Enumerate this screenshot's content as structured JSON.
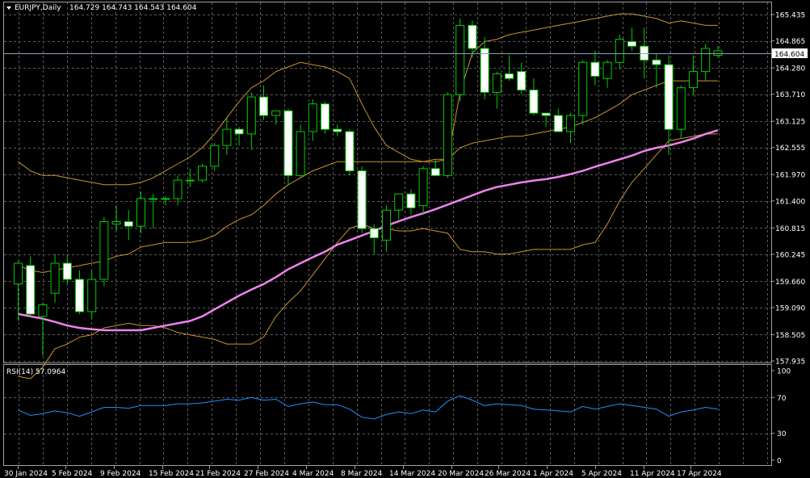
{
  "header": {
    "symbol_label": "EURJPY,Daily",
    "ohlc_text": "164.729 164.743 164.543 164.604",
    "rsi_label": "RSI(14) 57.0964"
  },
  "colors": {
    "background": "#000000",
    "grid": "#5a5a5a",
    "frame": "#a0a0a0",
    "candle_up_fill": "#000000",
    "candle_down_fill": "#ffffff",
    "candle_border": "#00cc00",
    "bollinger": "#c89430",
    "moving_average": "#ee82ee",
    "rsi_line": "#1e90ff",
    "price_line": "#8aa0c0"
  },
  "chart_data": [
    {
      "type": "candlestick",
      "symbol": "EURJPY",
      "timeframe": "Daily",
      "last_price": 164.604,
      "ylim": [
        157.935,
        165.435
      ],
      "y_ticks": [
        "165.435",
        "164.865",
        "164.280",
        "163.710",
        "163.125",
        "162.555",
        "161.970",
        "161.400",
        "160.815",
        "160.245",
        "159.660",
        "159.090",
        "158.505",
        "157.935"
      ],
      "x_ticks": [
        "30 Jan 2024",
        "5 Feb 2024",
        "9 Feb 2024",
        "15 Feb 2024",
        "21 Feb 2024",
        "27 Feb 2024",
        "4 Mar 2024",
        "8 Mar 2024",
        "14 Mar 2024",
        "20 Mar 2024",
        "26 Mar 2024",
        "1 Apr 2024",
        "5 Apr 2024",
        "11 Apr 2024",
        "17 Apr 2024"
      ],
      "candles": [
        {
          "o": 159.6,
          "h": 160.1,
          "l": 158.8,
          "c": 160.05
        },
        {
          "o": 160.0,
          "h": 160.2,
          "l": 158.9,
          "c": 158.95
        },
        {
          "o": 158.9,
          "h": 159.2,
          "l": 158.05,
          "c": 159.15
        },
        {
          "o": 159.4,
          "h": 160.25,
          "l": 159.2,
          "c": 160.05
        },
        {
          "o": 160.05,
          "h": 160.25,
          "l": 159.6,
          "c": 159.7
        },
        {
          "o": 159.7,
          "h": 159.9,
          "l": 158.95,
          "c": 159.0
        },
        {
          "o": 159.0,
          "h": 159.9,
          "l": 158.85,
          "c": 159.7
        },
        {
          "o": 159.7,
          "h": 161.05,
          "l": 159.55,
          "c": 160.95
        },
        {
          "o": 160.9,
          "h": 161.3,
          "l": 160.75,
          "c": 160.95
        },
        {
          "o": 160.95,
          "h": 161.2,
          "l": 160.55,
          "c": 160.85
        },
        {
          "o": 160.85,
          "h": 161.6,
          "l": 160.7,
          "c": 161.45
        },
        {
          "o": 161.45,
          "h": 161.55,
          "l": 160.8,
          "c": 161.45
        },
        {
          "o": 161.45,
          "h": 161.5,
          "l": 161.3,
          "c": 161.45
        },
        {
          "o": 161.45,
          "h": 161.95,
          "l": 161.3,
          "c": 161.85
        },
        {
          "o": 161.85,
          "h": 162.1,
          "l": 161.7,
          "c": 161.85
        },
        {
          "o": 161.85,
          "h": 162.2,
          "l": 161.8,
          "c": 162.15
        },
        {
          "o": 162.15,
          "h": 162.65,
          "l": 162.05,
          "c": 162.6
        },
        {
          "o": 162.6,
          "h": 163.2,
          "l": 162.4,
          "c": 162.95
        },
        {
          "o": 162.95,
          "h": 163.0,
          "l": 162.6,
          "c": 162.85
        },
        {
          "o": 162.85,
          "h": 163.75,
          "l": 162.5,
          "c": 163.65
        },
        {
          "o": 163.65,
          "h": 163.9,
          "l": 163.15,
          "c": 163.25
        },
        {
          "o": 163.25,
          "h": 163.35,
          "l": 163.05,
          "c": 163.35
        },
        {
          "o": 163.35,
          "h": 163.4,
          "l": 161.75,
          "c": 161.95
        },
        {
          "o": 161.95,
          "h": 163.05,
          "l": 161.9,
          "c": 162.9
        },
        {
          "o": 162.9,
          "h": 163.6,
          "l": 162.7,
          "c": 163.5
        },
        {
          "o": 163.5,
          "h": 163.55,
          "l": 162.85,
          "c": 162.95
        },
        {
          "o": 162.95,
          "h": 163.05,
          "l": 162.8,
          "c": 162.9
        },
        {
          "o": 162.9,
          "h": 162.95,
          "l": 161.95,
          "c": 162.05
        },
        {
          "o": 162.05,
          "h": 162.15,
          "l": 160.7,
          "c": 160.8
        },
        {
          "o": 160.8,
          "h": 160.9,
          "l": 160.25,
          "c": 160.6
        },
        {
          "o": 160.55,
          "h": 161.3,
          "l": 160.3,
          "c": 161.2
        },
        {
          "o": 161.2,
          "h": 161.55,
          "l": 161.0,
          "c": 161.55
        },
        {
          "o": 161.55,
          "h": 161.65,
          "l": 161.1,
          "c": 161.25
        },
        {
          "o": 161.3,
          "h": 162.15,
          "l": 161.1,
          "c": 162.1
        },
        {
          "o": 162.1,
          "h": 162.3,
          "l": 161.95,
          "c": 161.95
        },
        {
          "o": 161.95,
          "h": 163.75,
          "l": 161.9,
          "c": 163.7
        },
        {
          "o": 163.7,
          "h": 165.35,
          "l": 163.55,
          "c": 165.2
        },
        {
          "o": 165.2,
          "h": 165.3,
          "l": 164.5,
          "c": 164.7
        },
        {
          "o": 164.7,
          "h": 164.95,
          "l": 163.6,
          "c": 163.75
        },
        {
          "o": 163.75,
          "h": 164.2,
          "l": 163.4,
          "c": 164.15
        },
        {
          "o": 164.15,
          "h": 164.55,
          "l": 164.0,
          "c": 164.05
        },
        {
          "o": 164.2,
          "h": 164.4,
          "l": 163.7,
          "c": 163.8
        },
        {
          "o": 163.8,
          "h": 164.05,
          "l": 163.25,
          "c": 163.3
        },
        {
          "o": 163.3,
          "h": 163.3,
          "l": 163.0,
          "c": 163.25
        },
        {
          "o": 163.25,
          "h": 163.4,
          "l": 162.9,
          "c": 162.9
        },
        {
          "o": 162.9,
          "h": 163.3,
          "l": 162.65,
          "c": 163.25
        },
        {
          "o": 163.25,
          "h": 164.45,
          "l": 163.05,
          "c": 164.4
        },
        {
          "o": 164.4,
          "h": 164.65,
          "l": 163.9,
          "c": 164.1
        },
        {
          "o": 164.05,
          "h": 164.45,
          "l": 163.85,
          "c": 164.4
        },
        {
          "o": 164.4,
          "h": 165.0,
          "l": 164.25,
          "c": 164.9
        },
        {
          "o": 164.85,
          "h": 165.15,
          "l": 164.65,
          "c": 164.75
        },
        {
          "o": 164.75,
          "h": 165.15,
          "l": 164.05,
          "c": 164.45
        },
        {
          "o": 164.45,
          "h": 164.6,
          "l": 163.85,
          "c": 164.35
        },
        {
          "o": 164.35,
          "h": 164.55,
          "l": 162.4,
          "c": 162.95
        },
        {
          "o": 162.95,
          "h": 163.9,
          "l": 162.75,
          "c": 163.85
        },
        {
          "o": 163.85,
          "h": 164.55,
          "l": 163.7,
          "c": 164.2
        },
        {
          "o": 164.2,
          "h": 164.8,
          "l": 164.0,
          "c": 164.7
        },
        {
          "o": 164.55,
          "h": 164.75,
          "l": 164.5,
          "c": 164.65
        }
      ],
      "bollinger_upper": [
        162.25,
        162.05,
        161.95,
        161.95,
        161.9,
        161.85,
        161.8,
        161.75,
        161.75,
        161.75,
        161.8,
        161.9,
        162.05,
        162.2,
        162.35,
        162.55,
        162.85,
        163.2,
        163.55,
        163.85,
        164.0,
        164.2,
        164.3,
        164.4,
        164.35,
        164.3,
        164.2,
        164.05,
        163.5,
        163.0,
        162.6,
        162.45,
        162.3,
        162.25,
        162.3,
        162.3,
        163.75,
        164.6,
        164.85,
        164.9,
        165.0,
        165.05,
        165.1,
        165.15,
        165.2,
        165.25,
        165.3,
        165.35,
        165.4,
        165.45,
        165.45,
        165.4,
        165.35,
        165.25,
        165.3,
        165.25,
        165.2,
        165.2
      ],
      "bollinger_middle": [
        160.0,
        159.9,
        159.85,
        159.9,
        159.95,
        160.0,
        160.05,
        160.1,
        160.2,
        160.25,
        160.4,
        160.45,
        160.5,
        160.5,
        160.5,
        160.55,
        160.65,
        160.85,
        161.0,
        161.1,
        161.3,
        161.55,
        161.75,
        161.9,
        162.05,
        162.15,
        162.25,
        162.25,
        162.25,
        162.25,
        162.25,
        162.25,
        162.25,
        162.25,
        162.25,
        162.3,
        162.55,
        162.65,
        162.7,
        162.75,
        162.8,
        162.8,
        162.85,
        162.9,
        162.95,
        163.0,
        163.1,
        163.2,
        163.35,
        163.5,
        163.7,
        163.8,
        163.9,
        164.0,
        164.0,
        164.0,
        164.0,
        164.0
      ],
      "bollinger_lower": [
        157.6,
        157.55,
        157.8,
        158.2,
        158.3,
        158.45,
        158.5,
        158.65,
        158.7,
        158.75,
        158.7,
        158.7,
        158.65,
        158.55,
        158.5,
        158.45,
        158.4,
        158.3,
        158.3,
        158.3,
        158.45,
        158.9,
        159.2,
        159.45,
        159.8,
        160.15,
        160.5,
        160.8,
        160.9,
        160.8,
        160.8,
        160.75,
        160.75,
        160.8,
        160.75,
        160.7,
        160.35,
        160.3,
        160.3,
        160.25,
        160.25,
        160.3,
        160.35,
        160.35,
        160.35,
        160.35,
        160.45,
        160.5,
        160.9,
        161.4,
        161.8,
        162.1,
        162.4,
        162.7,
        162.75,
        162.8,
        162.85,
        162.85
      ],
      "moving_average": [
        158.95,
        158.9,
        158.85,
        158.78,
        158.7,
        158.65,
        158.62,
        158.6,
        158.6,
        158.6,
        158.6,
        158.65,
        158.7,
        158.75,
        158.8,
        158.9,
        159.05,
        159.2,
        159.35,
        159.48,
        159.6,
        159.75,
        159.92,
        160.05,
        160.18,
        160.3,
        160.45,
        160.55,
        160.65,
        160.75,
        160.86,
        160.96,
        161.05,
        161.13,
        161.22,
        161.32,
        161.42,
        161.52,
        161.62,
        161.7,
        161.75,
        161.8,
        161.84,
        161.87,
        161.92,
        161.98,
        162.05,
        162.14,
        162.22,
        162.3,
        162.38,
        162.48,
        162.55,
        162.6,
        162.67,
        162.75,
        162.85,
        162.93
      ]
    },
    {
      "type": "line",
      "series": [
        {
          "name": "RSI(14)",
          "values": [
            56,
            50,
            52,
            55,
            53,
            49,
            54,
            59,
            59,
            58,
            61,
            61,
            61,
            63,
            63,
            64,
            66,
            68,
            67,
            70,
            67,
            68,
            60,
            63,
            65,
            62,
            62,
            57,
            48,
            46,
            51,
            54,
            52,
            56,
            54,
            66,
            72,
            67,
            61,
            63,
            62,
            61,
            57,
            56,
            55,
            54,
            60,
            57,
            60,
            63,
            61,
            59,
            57,
            49,
            54,
            56,
            59,
            57
          ]
        }
      ],
      "ylim": [
        0,
        100
      ],
      "y_ticks": [
        "100",
        "70",
        "30",
        "0"
      ],
      "levels": [
        70,
        30
      ],
      "current_value": 57.0964
    }
  ]
}
